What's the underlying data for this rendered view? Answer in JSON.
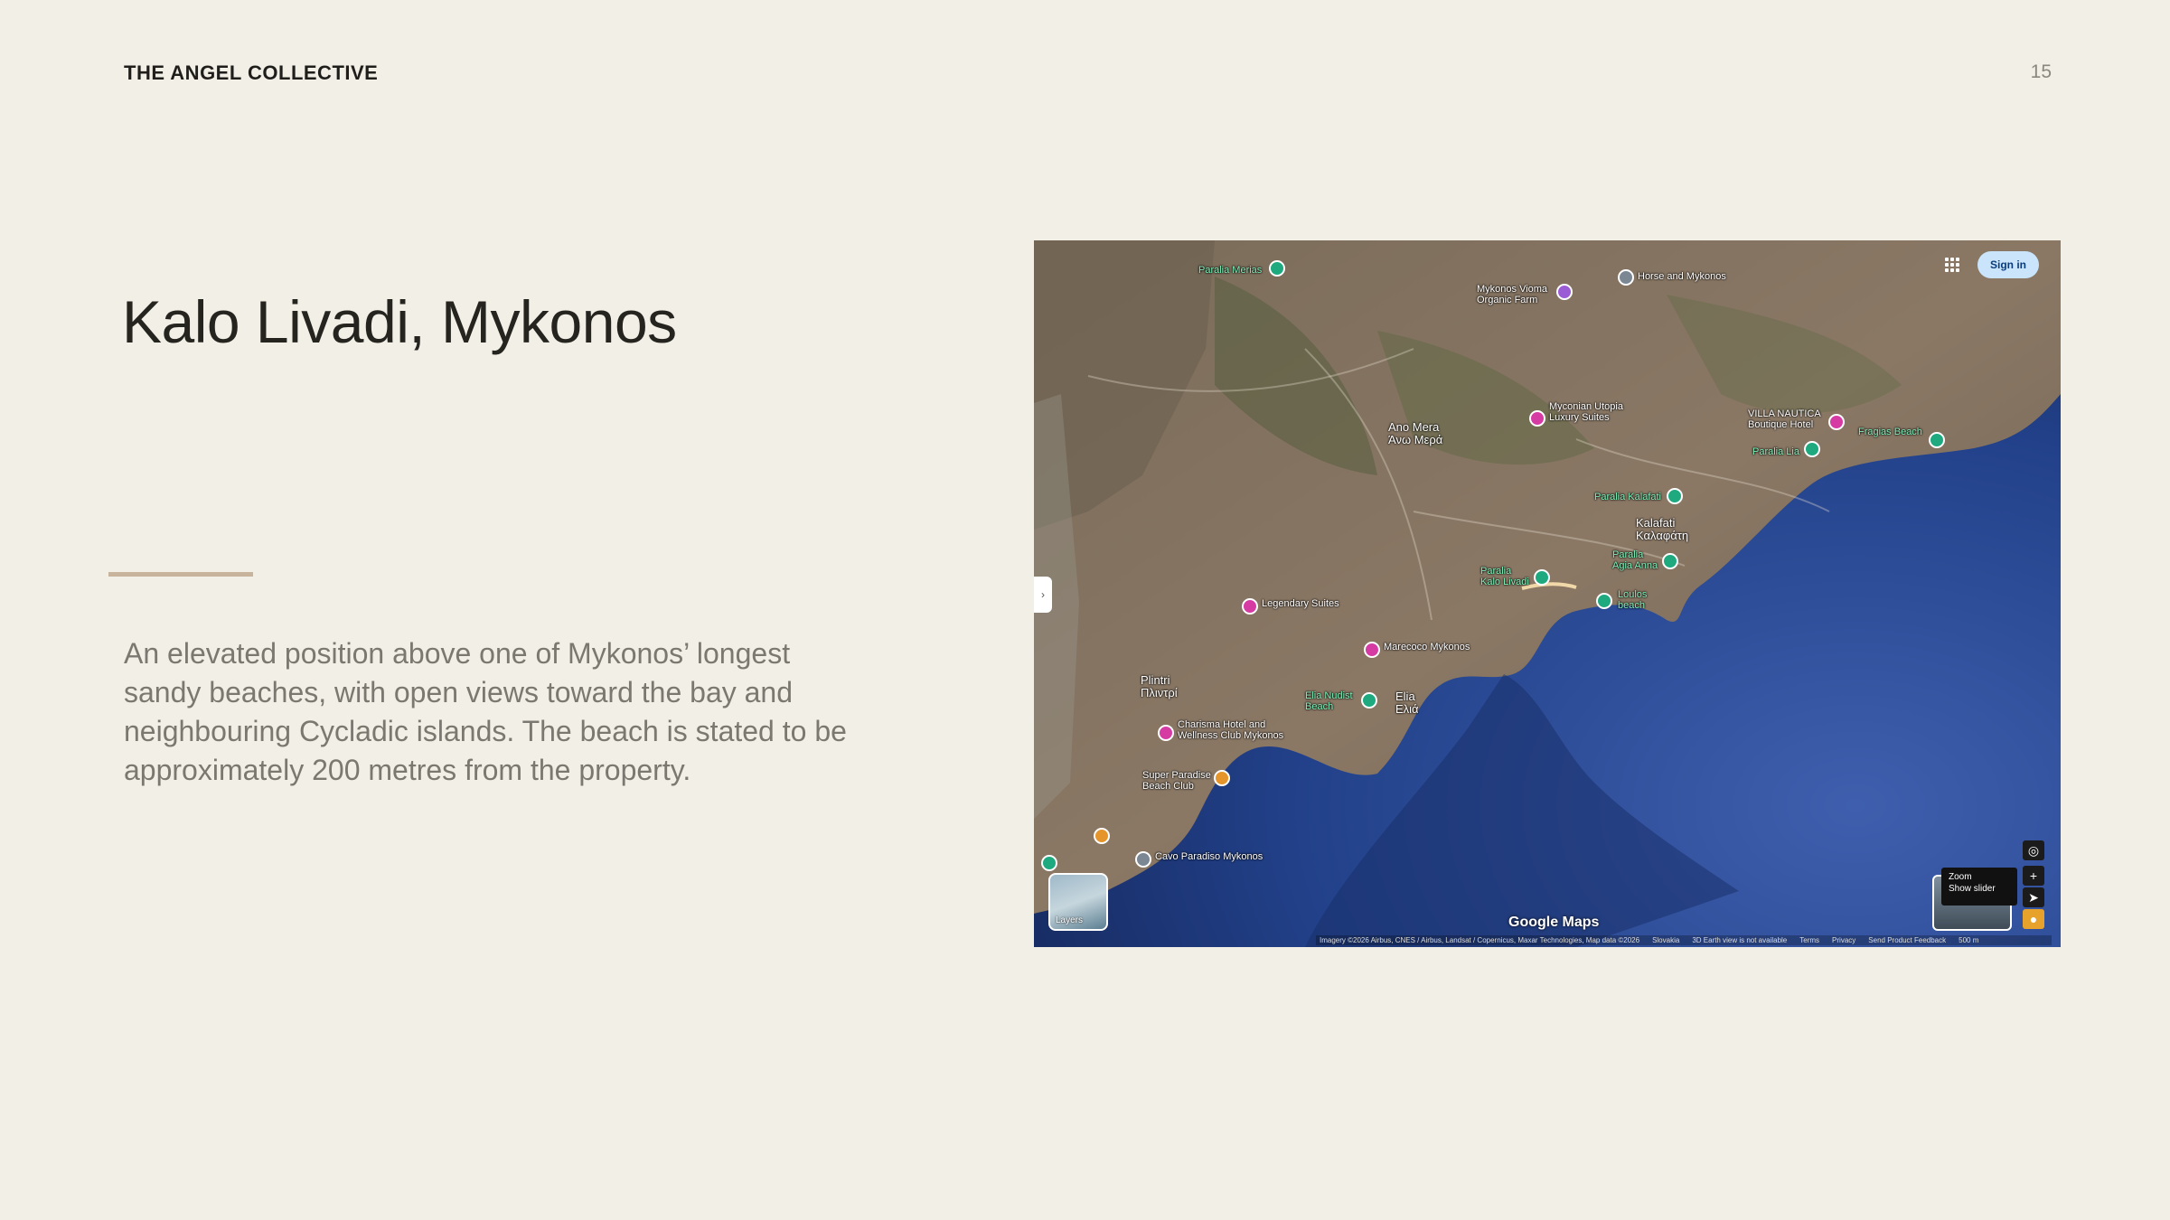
{
  "header": {
    "brand": "THE ANGEL COLLECTIVE",
    "page_number": "15"
  },
  "slide": {
    "title": "Kalo Livadi, Mykonos",
    "description": "An elevated position above one of Mykonos’ longest sandy beaches, with open views toward the bay and neighbouring Cycladic islands. The beach is stated to be approximately 200 metres from the property."
  },
  "map": {
    "sign_in": "Sign in",
    "layers_label": "Layers",
    "google_mark": "Google Maps",
    "zoom_tip_title": "Zoom",
    "zoom_tip_sub": "Show slider",
    "attribution": [
      "Imagery ©2026 Airbus, CNES / Airbus, Landsat / Copernicus, Maxar Technologies, Map data ©2026",
      "Slovakia",
      "3D Earth view is not available",
      "Terms",
      "Privacy",
      "Send Product Feedback",
      "500 m"
    ],
    "places": [
      {
        "name": "Paralia Merias",
        "type": "green"
      },
      {
        "name": "Mykonos Vioma Organic Farm",
        "type": "purple"
      },
      {
        "name": "Horse and Mykonos",
        "type": "grey"
      },
      {
        "name": "Ano Mera Άνω Μερά",
        "type": "label"
      },
      {
        "name": "Myconian Utopia Luxury Suites",
        "type": "pink"
      },
      {
        "name": "VILLA NAUTICA Boutique Hotel",
        "type": "pink"
      },
      {
        "name": "Paralia Lia",
        "type": "green"
      },
      {
        "name": "Fragias Beach",
        "type": "green"
      },
      {
        "name": "Paralia Kalafati",
        "type": "green"
      },
      {
        "name": "Kalafati Καλαφάτη",
        "type": "label"
      },
      {
        "name": "Paralia Agia Anna",
        "type": "green"
      },
      {
        "name": "Paralia Kalo Livadi",
        "type": "green"
      },
      {
        "name": "Loulos beach",
        "type": "green"
      },
      {
        "name": "Legendary Suites",
        "type": "pink"
      },
      {
        "name": "Marecoco Mykonos",
        "type": "pink"
      },
      {
        "name": "Plintri Πλιντρί",
        "type": "label"
      },
      {
        "name": "Elia Nudist Beach",
        "type": "green"
      },
      {
        "name": "Elia Ελιά",
        "type": "label"
      },
      {
        "name": "Charisma Hotel and Wellness Club Mykonos",
        "type": "pink"
      },
      {
        "name": "Super Paradise Beach Club",
        "type": "orange"
      },
      {
        "name": "Cavo Paradiso Mykonos",
        "type": "grey"
      }
    ]
  }
}
